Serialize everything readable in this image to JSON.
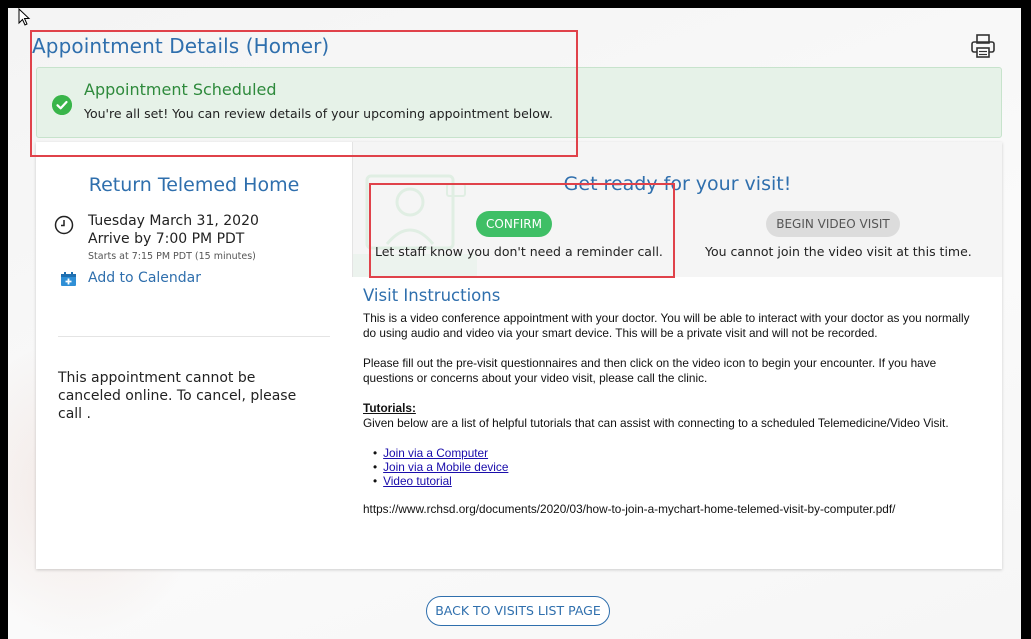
{
  "header": {
    "title": "Appointment Details (Homer)",
    "print_icon": "printer-icon"
  },
  "banner": {
    "heading": "Appointment Scheduled",
    "message": "You're all set! You can review details of your upcoming appointment below.",
    "icon": "check-circle-icon",
    "accent": "#39b54a"
  },
  "appointment": {
    "department": "Return Telemed Home",
    "date": "Tuesday March 31, 2020",
    "arrive": "Arrive by 7:00 PM PDT",
    "starts": "Starts at 7:15 PM PDT (15 minutes)",
    "add_to_calendar": "Add to Calendar",
    "cancel_note": "This appointment cannot be canceled online. To cancel, please call ."
  },
  "ready": {
    "title": "Get ready for your visit!",
    "confirm_label": "CONFIRM",
    "confirm_note": "Let staff know you don't need a reminder call.",
    "video_label": "BEGIN VIDEO VISIT",
    "video_note": "You cannot join the video visit at this time."
  },
  "instructions": {
    "heading": "Visit Instructions",
    "para1": "This is a video conference appointment with your doctor. You will be able to interact with your doctor as you normally do using audio and video via your smart device. This will be a private visit and will not be recorded.",
    "para2": "Please fill out the pre-visit questionnaires and then click on the video icon to begin your encounter. If you have questions or concerns about your video visit, please call the clinic.",
    "tutorials_heading": "Tutorials:",
    "tutorials_intro": "Given below are a list of helpful tutorials that can assist with connecting to a scheduled Telemedicine/Video Visit.",
    "links": [
      "Join via a Computer",
      "Join via a Mobile device",
      "Video tutorial"
    ],
    "url": "https://www.rchsd.org/documents/2020/03/how-to-join-a-mychart-home-telemed-visit-by-computer.pdf/"
  },
  "footer": {
    "back_label": "BACK TO VISITS LIST PAGE"
  }
}
